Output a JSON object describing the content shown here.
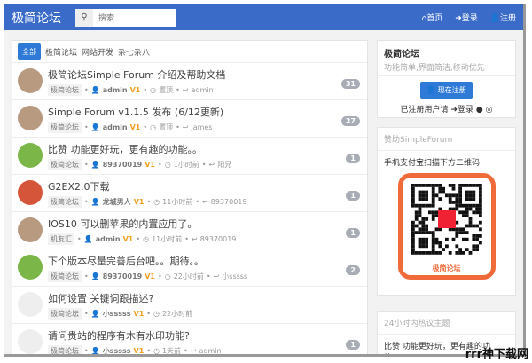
{
  "nav": {
    "brand": "极简论坛",
    "search_placeholder": "搜索",
    "home": "⌂首页",
    "login": "➜登录",
    "register": "👤注册"
  },
  "tabs": [
    "全部",
    "极简论坛",
    "网站开发",
    "杂七杂八"
  ],
  "topics": [
    {
      "title": "极简论坛Simple Forum 介绍及帮助文档",
      "node": "极简论坛",
      "user": "admin",
      "level": "V1",
      "time": "置顶",
      "reply": "admin",
      "count": "31",
      "avatar": "#b89a80"
    },
    {
      "title": "Simple Forum v1.1.5 发布 (6/12更新)",
      "node": "极简论坛",
      "user": "admin",
      "level": "V1",
      "time": "置顶",
      "reply": "james",
      "count": "27",
      "avatar": "#b89a80"
    },
    {
      "title": "比赞 功能更好玩，更有趣的功能。。",
      "node": "极简论坛",
      "user": "89370019",
      "level": "V1",
      "time": "1小时前",
      "reply": "阳兄",
      "count": "1",
      "avatar": "#7ab648"
    },
    {
      "title": "G2EX2.0下载",
      "node": "极简论坛",
      "user": "龙城男人",
      "level": "V1",
      "time": "11小时前",
      "reply": "89370019",
      "count": "1",
      "avatar": "#d5553a"
    },
    {
      "title": "IOS10 可以删苹果的内置应用了。",
      "node": "机友汇",
      "user": "admin",
      "level": "V1",
      "time": "11小时前",
      "reply": "89370019",
      "count": "1",
      "avatar": "#b89a80"
    },
    {
      "title": "下个版本尽量完善后台吧。。期待。。",
      "node": "极简论坛",
      "user": "89370019",
      "level": "V1",
      "time": "22小时前",
      "reply": "小sssss",
      "count": "2",
      "avatar": "#7ab648"
    },
    {
      "title": "如何设置 关键词跟描述?",
      "node": "极简论坛",
      "user": "小sssss",
      "level": "V1",
      "time": "22小时前",
      "reply": null,
      "count": null,
      "avatar": "#eeeeee"
    },
    {
      "title": "请问贵站的程序有木有水印功能?",
      "node": "极简论坛",
      "user": "小sssss",
      "level": "V1",
      "time": "1天前",
      "reply": "admin",
      "count": "1",
      "avatar": "#eeeeee"
    }
  ],
  "side": {
    "title": "极简论坛",
    "desc": "功能简单,界面简洁,移动优先",
    "register_btn": "现在注册",
    "login_hint": "已注册用户请",
    "login_link": "➜登录",
    "donate_title": "赞助SimpleForum",
    "donate_text": "手机支付宝扫描下方二维码",
    "qr_label": "极简论坛",
    "hot_title": "24小时内热议主题",
    "hot_item": "比赞 功能更好玩，更有趣的功能。。"
  },
  "watermark": "rrr神下载网",
  "colors": {
    "nav": "#3b6bc8",
    "accent": "#2f7ad6",
    "level": "#f0a020"
  }
}
